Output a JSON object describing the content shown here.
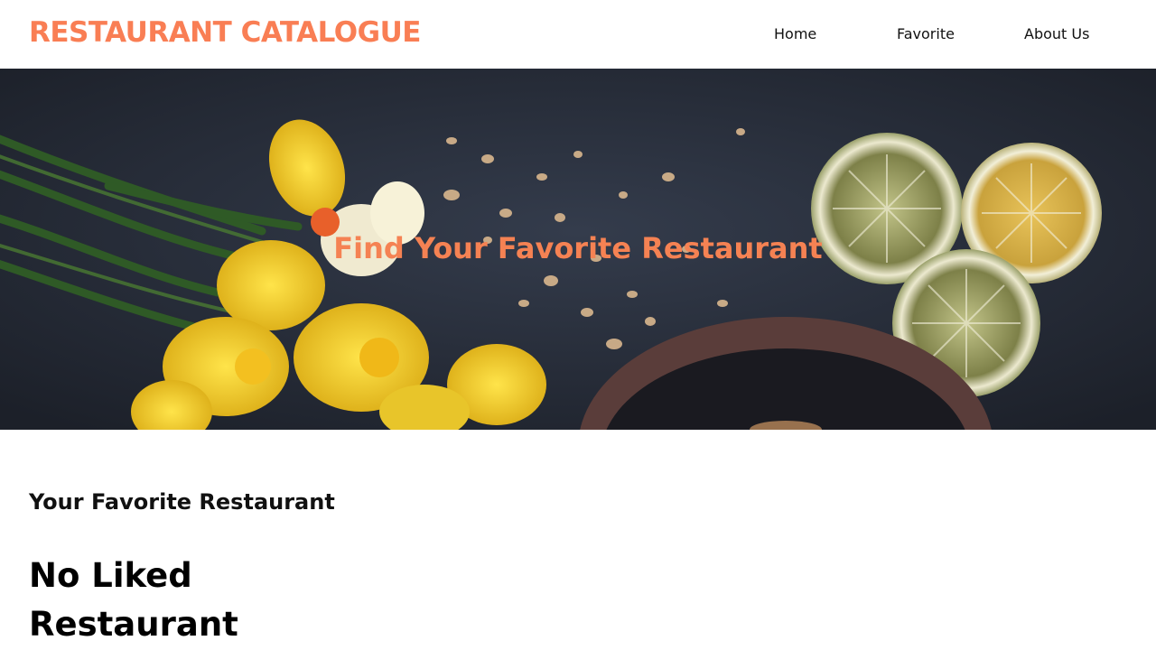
{
  "header": {
    "brand": "RESTAURANT CATALOGUE",
    "nav": {
      "home": "Home",
      "favorite": "Favorite",
      "about": "About Us"
    }
  },
  "hero": {
    "title": "Find Your Favorite Restaurant",
    "image": "hero-food-image"
  },
  "main": {
    "section_heading": "Your Favorite Restaurant",
    "empty_state": "No Liked Restaurant"
  },
  "colors": {
    "accent": "#f97e54",
    "text": "#111111",
    "background": "#ffffff",
    "hero_dark": "#262c38"
  }
}
